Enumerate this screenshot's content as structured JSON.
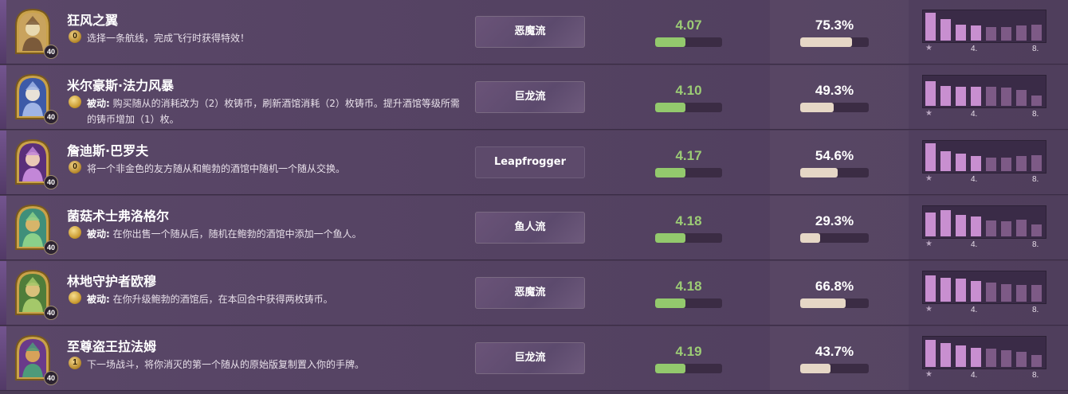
{
  "colors": {
    "rank_green": "#9ccc75",
    "bar_top4": "#c88fd0",
    "bar_bottom4": "#7d5a86",
    "pct_fill": "#e6d7c6"
  },
  "dist_labels": {
    "four": "4.",
    "eight": "8."
  },
  "heroes": [
    {
      "name": "狂风之翼",
      "armor": "40",
      "power_icon": "0",
      "power_type": "active",
      "power_keyword": "",
      "power_text": "选择一条航线，完成飞行时获得特效！",
      "tag": "恶魔流",
      "avg_place": "4.07",
      "avg_place_fill": 0.45,
      "pick_rate": "75.3%",
      "pick_rate_fill": 0.753,
      "distribution": [
        0.92,
        0.7,
        0.52,
        0.5,
        0.46,
        0.46,
        0.5,
        0.52
      ],
      "icon": "gryphon-portrait"
    },
    {
      "name": "米尔豪斯·法力风暴",
      "armor": "40",
      "power_icon": "",
      "power_type": "passive",
      "power_keyword": "被动:",
      "power_text": " 购买随从的消耗改为（2）枚铸币，刷新酒馆消耗（2）枚铸币。提升酒馆等级所需的铸币增加（1）枚。",
      "tag": "巨龙流",
      "avg_place": "4.10",
      "avg_place_fill": 0.45,
      "pick_rate": "49.3%",
      "pick_rate_fill": 0.493,
      "distribution": [
        0.82,
        0.66,
        0.62,
        0.62,
        0.64,
        0.6,
        0.52,
        0.34
      ],
      "icon": "wizard-portrait"
    },
    {
      "name": "詹迪斯·巴罗夫",
      "armor": "40",
      "power_icon": "0",
      "power_type": "active",
      "power_keyword": "",
      "power_text": "将一个非金色的友方随从和鲍勃的酒馆中随机一个随从交换。",
      "tag": "Leapfrogger",
      "avg_place": "4.17",
      "avg_place_fill": 0.45,
      "pick_rate": "54.6%",
      "pick_rate_fill": 0.546,
      "distribution": [
        0.92,
        0.66,
        0.58,
        0.5,
        0.46,
        0.46,
        0.5,
        0.52
      ],
      "icon": "sorceress-portrait"
    },
    {
      "name": "菌菇术士弗洛格尔",
      "armor": "40",
      "power_icon": "",
      "power_type": "passive",
      "power_keyword": "被动:",
      "power_text": " 在你出售一个随从后，随机在鲍勃的酒馆中添加一个鱼人。",
      "tag": "鱼人流",
      "avg_place": "4.18",
      "avg_place_fill": 0.45,
      "pick_rate": "29.3%",
      "pick_rate_fill": 0.293,
      "distribution": [
        0.78,
        0.88,
        0.72,
        0.66,
        0.52,
        0.5,
        0.54,
        0.4
      ],
      "icon": "murloc-portrait"
    },
    {
      "name": "林地守护者欧穆",
      "armor": "40",
      "power_icon": "",
      "power_type": "passive",
      "power_keyword": "被动:",
      "power_text": " 在你升级鲍勃的酒馆后，在本回合中获得两枚铸币。",
      "tag": "恶魔流",
      "avg_place": "4.18",
      "avg_place_fill": 0.45,
      "pick_rate": "66.8%",
      "pick_rate_fill": 0.668,
      "distribution": [
        0.88,
        0.8,
        0.76,
        0.68,
        0.62,
        0.58,
        0.56,
        0.54
      ],
      "icon": "treant-portrait"
    },
    {
      "name": "至尊盗王拉法姆",
      "armor": "40",
      "power_icon": "1",
      "power_type": "active",
      "power_keyword": "",
      "power_text": "下一场战斗，将你消灭的第一个随从的原始版复制置入你的手牌。",
      "tag": "巨龙流",
      "avg_place": "4.19",
      "avg_place_fill": 0.45,
      "pick_rate": "43.7%",
      "pick_rate_fill": 0.437,
      "distribution": [
        0.9,
        0.8,
        0.72,
        0.64,
        0.6,
        0.56,
        0.5,
        0.4
      ],
      "icon": "rafaam-portrait"
    }
  ]
}
